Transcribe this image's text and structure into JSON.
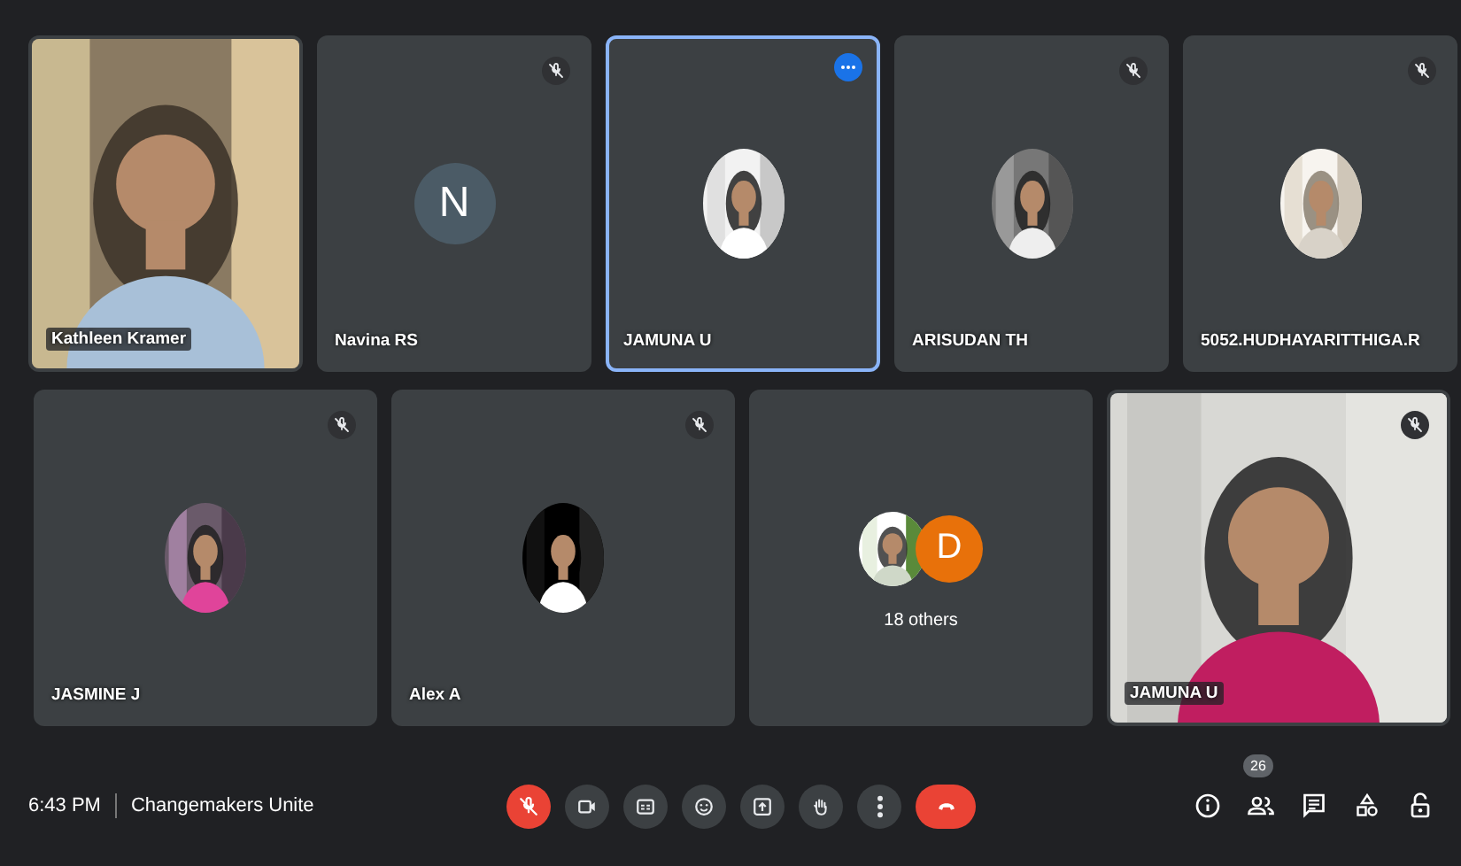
{
  "tiles": [
    {
      "kind": "video",
      "name": "Kathleen Kramer",
      "muted": false,
      "selected": false
    },
    {
      "kind": "letter",
      "name": "Navina RS",
      "letter": "N",
      "color": "#4b5b66",
      "muted": true,
      "selected": false
    },
    {
      "kind": "avatar",
      "name": "JAMUNA U",
      "muted": false,
      "selected": true
    },
    {
      "kind": "avatar",
      "name": "ARISUDAN TH",
      "muted": true,
      "selected": false
    },
    {
      "kind": "avatar",
      "name": "5052.HUDHAYARITTHIGA.R",
      "muted": true,
      "selected": false
    },
    {
      "kind": "avatar",
      "name": "JASMINE J",
      "muted": true,
      "selected": false
    },
    {
      "kind": "avatar",
      "name": "Alex A",
      "muted": true,
      "selected": false
    },
    {
      "kind": "others",
      "label": "18 others",
      "letter": "D",
      "color": "#e8710a",
      "muted": false,
      "selected": false
    },
    {
      "kind": "video",
      "name": "JAMUNA U",
      "muted": true,
      "selected": false
    }
  ],
  "bar": {
    "time": "6:43 PM",
    "meeting": "Changemakers Unite",
    "controls": [
      {
        "kind": "mic",
        "on": false
      },
      {
        "kind": "camera",
        "on": true
      },
      {
        "kind": "captions"
      },
      {
        "kind": "emoji"
      },
      {
        "kind": "present"
      },
      {
        "kind": "hand"
      },
      {
        "kind": "more"
      },
      {
        "kind": "leave"
      }
    ],
    "tools": [
      {
        "kind": "info"
      },
      {
        "kind": "people",
        "badge": "26"
      },
      {
        "kind": "chat"
      },
      {
        "kind": "activities"
      },
      {
        "kind": "lock"
      }
    ]
  }
}
